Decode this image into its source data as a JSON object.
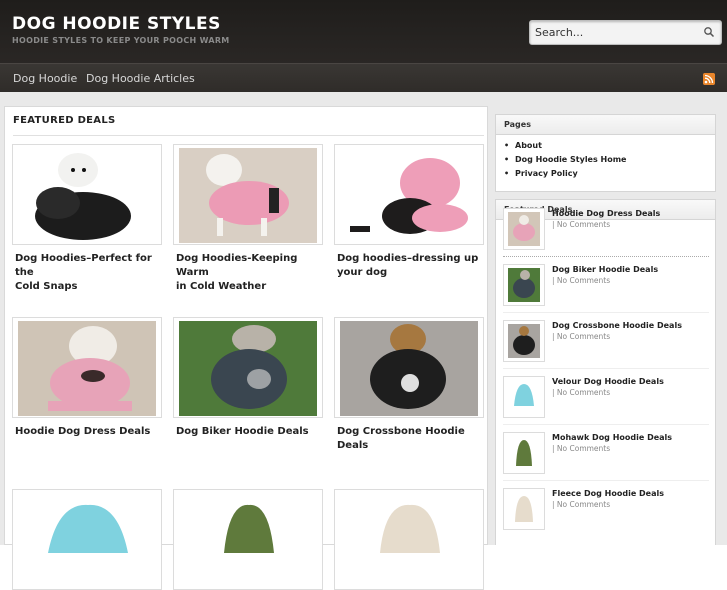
{
  "header": {
    "site_title": "DOG HOODIE STYLES",
    "tagline": "HOODIE STYLES TO KEEP YOUR POOCH WARM",
    "search_placeholder": "Search..."
  },
  "nav": {
    "items": [
      "Dog Hoodie",
      "Dog Hoodie Articles"
    ],
    "rss_icon": "rss-icon"
  },
  "main": {
    "section_title": "FEATURED DEALS",
    "cards": [
      {
        "title_line1": "Dog Hoodies–Perfect for the",
        "title_line2": "Cold Snaps"
      },
      {
        "title_line1": "Dog Hoodies-Keeping Warm",
        "title_line2": "in Cold Weather"
      },
      {
        "title_line1": "Dog hoodies–dressing up",
        "title_line2": "your dog"
      },
      {
        "title_line1": "Hoodie Dog Dress Deals",
        "title_line2": ""
      },
      {
        "title_line1": "Dog Biker Hoodie Deals",
        "title_line2": ""
      },
      {
        "title_line1": "Dog Crossbone Hoodie",
        "title_line2": "Deals"
      }
    ]
  },
  "sidebar": {
    "pages_title": "Pages",
    "pages": [
      "About",
      "Dog Hoodie Styles Home",
      "Privacy Policy"
    ],
    "deals_title": "Featured Deals",
    "deals": [
      {
        "title": "Hoodie Dog Dress Deals",
        "meta": "| No Comments"
      },
      {
        "title": "Dog Biker Hoodie Deals",
        "meta": "| No Comments"
      },
      {
        "title": "Dog Crossbone Hoodie Deals",
        "meta": "| No Comments"
      },
      {
        "title": "Velour Dog Hoodie Deals",
        "meta": "| No Comments"
      },
      {
        "title": "Mohawk Dog Hoodie Deals",
        "meta": "| No Comments"
      },
      {
        "title": "Fleece Dog Hoodie Deals",
        "meta": "| No Comments"
      }
    ]
  }
}
